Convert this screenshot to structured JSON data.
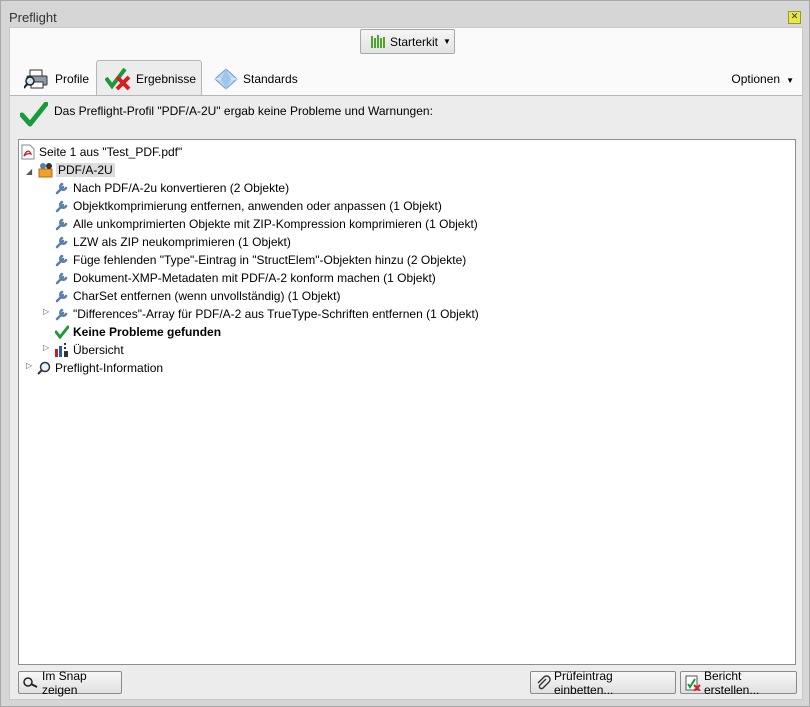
{
  "window": {
    "title": "Preflight",
    "close_icon": "close-icon"
  },
  "toolbar": {
    "starterkit_label": "Starterkit"
  },
  "tabs": [
    {
      "label": "Profile",
      "icon": "printer-magnifier-icon"
    },
    {
      "label": "Ergebnisse",
      "icon": "check-cross-icon",
      "active": true
    },
    {
      "label": "Standards",
      "icon": "diamond-icon"
    }
  ],
  "options_label": "Optionen",
  "summary_text": "Das Preflight-Profil \"PDF/A-2U\" ergab keine Probleme und Warnungen:",
  "tree": {
    "page": "Seite 1 aus \"Test_PDF.pdf\"",
    "profile": "PDF/A-2U",
    "fixups": [
      "Nach PDF/A-2u konvertieren (2 Objekte)",
      "Objektkomprimierung entfernen, anwenden oder anpassen (1 Objekt)",
      "Alle unkomprimierten Objekte mit ZIP-Kompression komprimieren (1 Objekt)",
      "LZW als ZIP neukomprimieren (1 Objekt)",
      "Füge fehlenden \"Type\"-Eintrag in \"StructElem\"-Objekten hinzu (2 Objekte)",
      "Dokument-XMP-Metadaten mit PDF/A-2 konform machen (1 Objekt)",
      "CharSet entfernen (wenn unvollständig) (1 Objekt)",
      "\"Differences\"-Array für PDF/A-2 aus TrueType-Schriften entfernen (1 Objekt)"
    ],
    "no_problems": "Keine Probleme gefunden",
    "overview": "Übersicht",
    "preflight_info": "Preflight-Information"
  },
  "buttons": {
    "snap": "Im Snap zeigen",
    "embed": "Prüfeintrag einbetten...",
    "report": "Bericht erstellen..."
  },
  "colors": {
    "check_green": "#1a9a3a",
    "cross_red": "#d42020",
    "wrench_blue": "#5a7fa8",
    "pdf_red": "#c8202a"
  }
}
